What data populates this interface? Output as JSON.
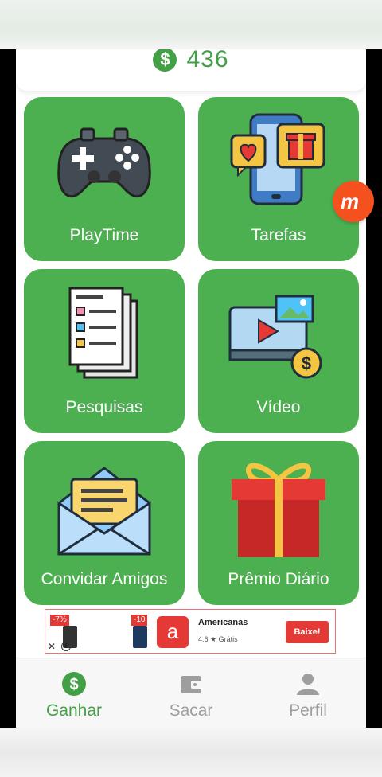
{
  "balance": {
    "icon": "dollar-coin-icon",
    "currency_symbol": "$",
    "value": "436"
  },
  "tiles": [
    {
      "label": "PlayTime",
      "icon": "gamepad-icon"
    },
    {
      "label": "Tarefas",
      "icon": "phone-gift-icon"
    },
    {
      "label": "Pesquisas",
      "icon": "survey-checklist-icon"
    },
    {
      "label": "Vídeo",
      "icon": "video-player-icon"
    },
    {
      "label": "Convidar Amigos",
      "icon": "envelope-letter-icon"
    },
    {
      "label": "Prêmio Diário",
      "icon": "gift-box-icon"
    }
  ],
  "ad": {
    "badge_1": "-7%",
    "badge_2": "-10",
    "logo_letter": "a",
    "title": "Americanas",
    "meta": "4.6 ★  Grátis",
    "cta": "Baixe!",
    "close": "✕",
    "info": "i"
  },
  "floating_button": {
    "letter": "m"
  },
  "nav": {
    "items": [
      {
        "label": "Ganhar",
        "icon": "dollar-coin-icon",
        "active": true
      },
      {
        "label": "Sacar",
        "icon": "wallet-icon",
        "active": false
      },
      {
        "label": "Perfil",
        "icon": "person-icon",
        "active": false
      }
    ]
  },
  "colors": {
    "primary_green": "#4caf50",
    "accent_green": "#43a047",
    "inactive_gray": "#9e9e9e",
    "ad_red": "#e53935"
  }
}
